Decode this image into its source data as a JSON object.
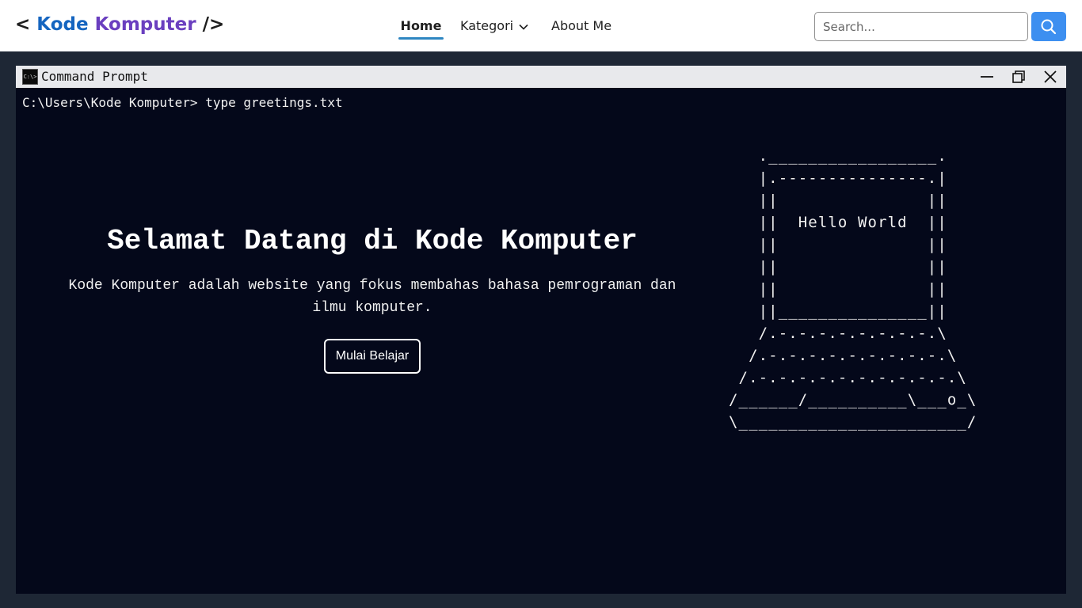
{
  "brand": {
    "open": "< ",
    "word1": "Kode",
    "word2": "Komputer",
    "close": " />"
  },
  "nav": {
    "home": "Home",
    "kategori": "Kategori",
    "about": "About Me"
  },
  "search": {
    "placeholder": "Search..."
  },
  "window": {
    "title": "Command Prompt",
    "icon_text": "C:\\>"
  },
  "terminal": {
    "prompt": "C:\\Users\\Kode Komputer> type greetings.txt",
    "hero_title": "Selamat Datang di Kode Komputer",
    "hero_desc": "Kode Komputer adalah website yang fokus membahas bahasa pemrograman dan ilmu komputer.",
    "cta_label": "Mulai Belajar",
    "ascii_art": "   ._________________.\n   |.---------------.|\n   ||               ||\n   ||  Hello World  ||\n   ||               ||\n   ||               ||\n   ||               ||\n   ||_______________||\n   /.-.-.-.-.-.-.-.-.\\\n  /.-.-.-.-.-.-.-.-.-.\\\n /.-.-.-.-.-.-.-.-.-.-.\\\n/______/__________\\___o_\\\n\\_______________________/"
  },
  "colors": {
    "accent": "#3d8ff0",
    "brand_blue": "#1565c0",
    "brand_purple": "#6a3fbf",
    "terminal_bg": "#04081a"
  },
  "icons": {
    "search": "search-icon",
    "chevron": "chevron-down-icon",
    "minimize": "minimize-icon",
    "maximize": "restore-icon",
    "close": "close-icon"
  }
}
